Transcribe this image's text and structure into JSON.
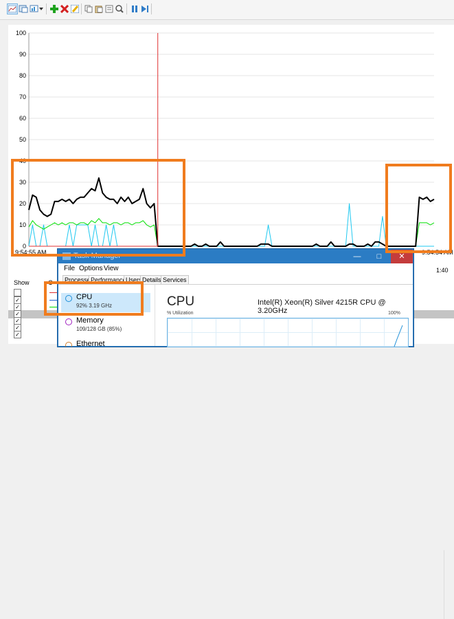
{
  "toolbar": {
    "buttons": [
      "view-current-activity-icon",
      "view-log-data-icon",
      "change-graph-type-icon",
      "add-counter-icon",
      "delete-counter-icon",
      "highlight-icon",
      "copy-properties-icon",
      "paste-counter-list-icon",
      "properties-icon",
      "zoom-icon",
      "freeze-display-icon",
      "update-data-icon"
    ]
  },
  "monitor": {
    "y_ticks": [
      "100",
      "90",
      "80",
      "70",
      "60",
      "50",
      "40",
      "30",
      "20",
      "10",
      "0"
    ],
    "x_start": "9:54:55 AM",
    "x_end": "9:54:54 AM",
    "duration_partial": "1:40",
    "counter_header": "Show",
    "counter_header_col2": "C"
  },
  "colors": {
    "highlight": "#f07c1e",
    "black_series": "#000000",
    "green_series": "#00e000",
    "cyan_series": "#1ec8f0",
    "red_line": "#e03030",
    "magenta_line": "#c020c0",
    "titlebar": "#2b7cc4"
  },
  "chart_data": {
    "type": "line",
    "ylim": [
      0,
      100
    ],
    "series": [
      {
        "values": [
          17,
          24,
          23,
          17,
          15,
          14,
          15,
          21,
          21,
          22,
          21,
          22,
          20,
          22,
          23,
          23,
          25,
          27,
          26,
          32,
          25,
          23,
          22,
          22,
          20,
          23,
          21,
          23,
          20,
          21,
          22,
          27,
          20,
          18,
          20,
          0,
          0,
          0,
          0,
          0,
          0,
          0,
          0,
          0,
          0,
          1,
          0,
          0,
          1,
          0,
          0,
          0,
          2,
          0,
          0,
          0,
          0,
          0,
          0,
          0,
          0,
          0,
          0,
          1,
          1,
          1,
          0,
          0,
          0,
          0,
          0,
          0,
          0,
          0,
          0,
          0,
          0,
          0,
          1,
          0,
          0,
          0,
          2,
          0,
          0,
          0,
          0,
          1,
          1,
          0,
          0,
          0,
          1,
          0,
          2,
          2,
          1,
          0,
          0,
          0,
          0,
          0,
          0,
          0,
          0,
          0,
          23,
          22,
          23,
          21,
          22
        ]
      },
      {
        "values": [
          9,
          12,
          10,
          9,
          8,
          9,
          10,
          11,
          10,
          11,
          10,
          11,
          11,
          10,
          11,
          11,
          10,
          12,
          11,
          13,
          11,
          11,
          10,
          11,
          11,
          10,
          11,
          11,
          10,
          11,
          11,
          12,
          10,
          9,
          10,
          0,
          0,
          0,
          0,
          0,
          0,
          0,
          0,
          0,
          0,
          1,
          0,
          0,
          1,
          0,
          0,
          0,
          2,
          0,
          0,
          0,
          0,
          0,
          0,
          0,
          0,
          0,
          0,
          1,
          1,
          1,
          0,
          0,
          0,
          0,
          0,
          0,
          0,
          0,
          0,
          0,
          0,
          0,
          1,
          0,
          0,
          0,
          2,
          0,
          0,
          0,
          0,
          1,
          1,
          0,
          0,
          0,
          1,
          0,
          2,
          2,
          1,
          0,
          0,
          0,
          0,
          0,
          0,
          0,
          0,
          0,
          11,
          11,
          11,
          10,
          11
        ]
      },
      {
        "values": [
          0,
          10,
          0,
          0,
          10,
          0,
          0,
          0,
          0,
          0,
          0,
          10,
          0,
          10,
          10,
          10,
          10,
          0,
          10,
          0,
          0,
          10,
          0,
          10,
          0,
          0,
          0,
          0,
          0,
          0,
          0,
          0,
          0,
          0,
          0,
          0,
          0,
          0,
          0,
          0,
          0,
          0,
          0,
          0,
          0,
          0,
          0,
          0,
          0,
          0,
          0,
          0,
          0,
          0,
          0,
          0,
          0,
          0,
          0,
          0,
          0,
          0,
          0,
          0,
          0,
          10,
          0,
          0,
          0,
          0,
          0,
          0,
          0,
          0,
          0,
          0,
          0,
          0,
          0,
          0,
          0,
          0,
          0,
          0,
          0,
          0,
          0,
          20,
          0,
          0,
          0,
          0,
          0,
          0,
          0,
          0,
          14,
          0,
          0,
          0,
          0,
          0,
          0,
          0,
          0,
          0,
          0,
          0,
          0,
          0,
          0
        ]
      }
    ]
  },
  "taskmanager": {
    "title": "Task Manager",
    "min_symbol": "—",
    "max_symbol": "□",
    "close_symbol": "✕",
    "menu": [
      "File",
      "Options",
      "View"
    ],
    "tabs": [
      "Processes",
      "Performance",
      "Users",
      "Details",
      "Services"
    ],
    "resources": [
      {
        "name": "CPU",
        "detail": "92%  3.19 GHz",
        "color": "#1e8fd8"
      },
      {
        "name": "Memory",
        "detail": "109/128 GB (85%)",
        "color": "#a020c0"
      },
      {
        "name": "Ethernet",
        "detail": "",
        "color": "#d08030"
      }
    ],
    "cpu_heading": "CPU",
    "cpu_model": "Intel(R) Xeon(R) Silver 4215R CPU @ 3.20GHz",
    "util_label": "% Utilization",
    "util_max": "100%"
  }
}
